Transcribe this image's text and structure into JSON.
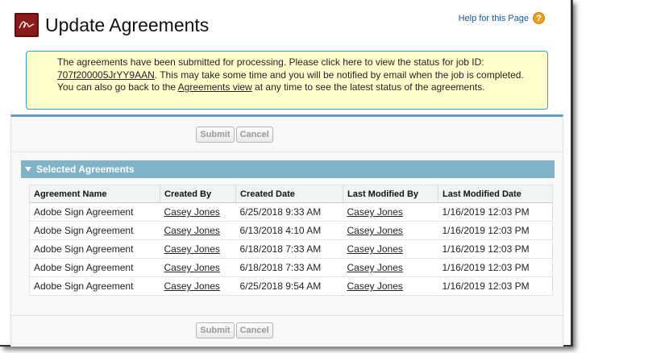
{
  "header": {
    "title": "Update Agreements",
    "help_label": "Help for this Page",
    "help_icon": "question-mark-icon"
  },
  "message": {
    "part1": "The agreements have been submitted for processing. Please click here to view the status for job ID: ",
    "job_id": "707f200005JrYY9AAN",
    "part2": ". This may take some time and you will be notified by email when the job is completed. You can also go back to the ",
    "agreements_view_link": "Agreements view",
    "part3": " at any time to see the latest status of the agreements."
  },
  "buttons": {
    "submit": "Submit",
    "cancel": "Cancel"
  },
  "section": {
    "title": "Selected Agreements"
  },
  "table": {
    "columns": [
      "Agreement Name",
      "Created By",
      "Created Date",
      "Last Modified By",
      "Last Modified Date"
    ],
    "rows": [
      [
        "Adobe Sign Agreement",
        "Casey Jones",
        "6/25/2018 9:33 AM",
        "Casey Jones",
        "1/16/2019 12:03 PM"
      ],
      [
        "Adobe Sign Agreement",
        "Casey Jones",
        "6/13/2018 4:10 AM",
        "Casey Jones",
        "1/16/2019 12:03 PM"
      ],
      [
        "Adobe Sign Agreement",
        "Casey Jones",
        "6/18/2018 7:33 AM",
        "Casey Jones",
        "1/16/2019 12:03 PM"
      ],
      [
        "Adobe Sign Agreement",
        "Casey Jones",
        "6/18/2018 7:33 AM",
        "Casey Jones",
        "1/16/2019 12:03 PM"
      ],
      [
        "Adobe Sign Agreement",
        "Casey Jones",
        "6/25/2018 9:54 AM",
        "Casey Jones",
        "1/16/2019 12:03 PM"
      ]
    ]
  },
  "colors": {
    "accent": "#5aa0c6",
    "section_header": "#7fb3c8",
    "message_bg": "#ffffcc",
    "logo": "#8b1a1a"
  }
}
